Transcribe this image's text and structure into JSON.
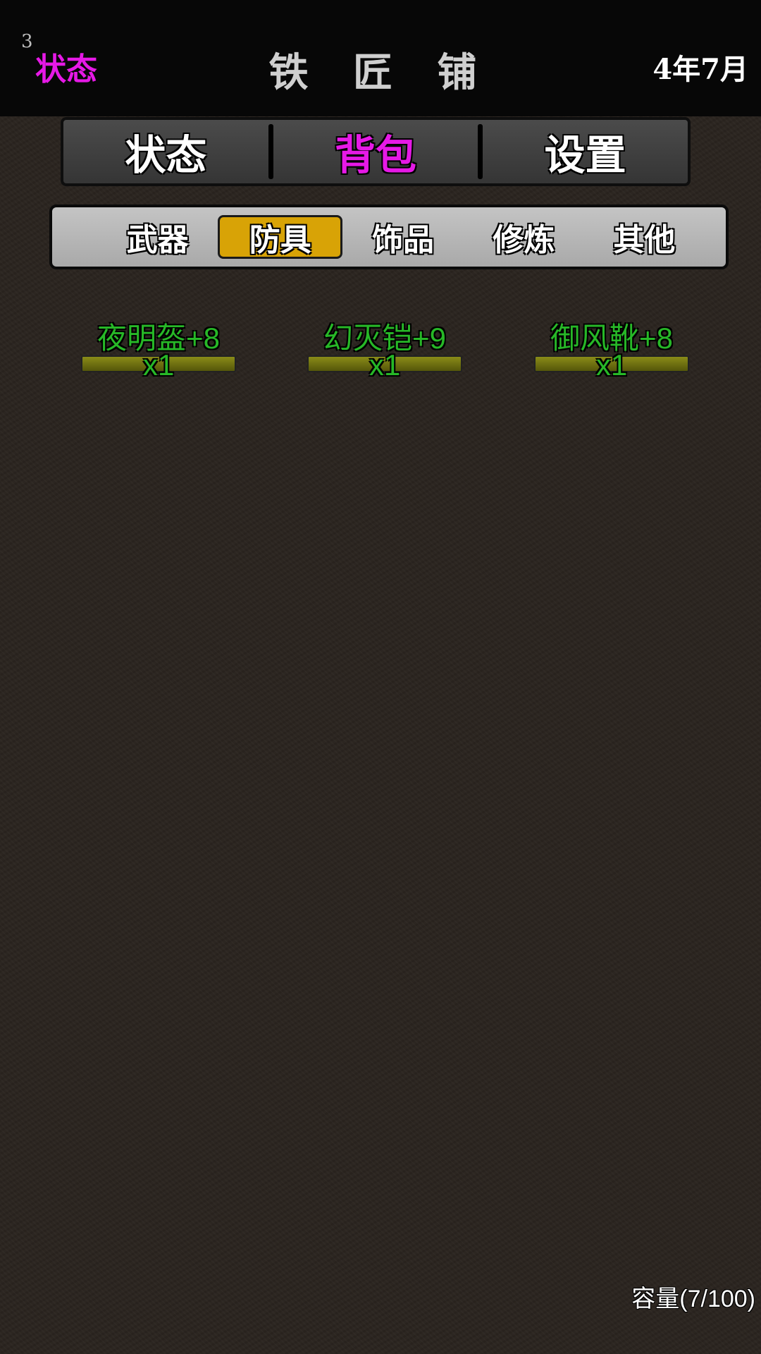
{
  "header": {
    "status_count": "3",
    "status_label": "状态",
    "title": "铁 匠 铺",
    "date": "4年7月"
  },
  "main_tabs": [
    {
      "label": "状态",
      "active": false
    },
    {
      "label": "背包",
      "active": true
    },
    {
      "label": "设置",
      "active": false
    }
  ],
  "sub_tabs": [
    {
      "label": "武器",
      "active": false
    },
    {
      "label": "防具",
      "active": true
    },
    {
      "label": "饰品",
      "active": false
    },
    {
      "label": "修炼",
      "active": false
    },
    {
      "label": "其他",
      "active": false
    }
  ],
  "items": [
    {
      "name": "夜明盔+8",
      "quantity": "x1"
    },
    {
      "name": "幻灭铠+9",
      "quantity": "x1"
    },
    {
      "name": "御风靴+8",
      "quantity": "x1"
    }
  ],
  "capacity": "容量(7/100)",
  "colors": {
    "active_main_tab": "#e619e6",
    "active_sub_tab_bg": "#d8a306",
    "item_text": "#27b827",
    "item_bar": "#7a7c14"
  }
}
